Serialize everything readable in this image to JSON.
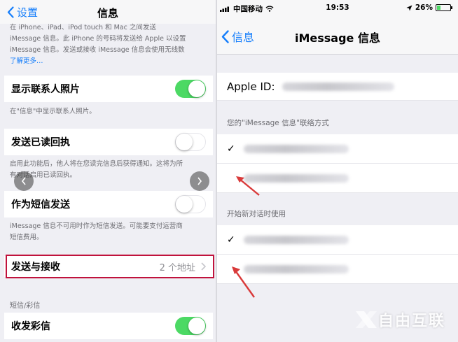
{
  "left": {
    "back_label": "设置",
    "title": "信息",
    "intro_lines": [
      "在 iPhone、iPad、iPod touch 和 Mac 之间发送",
      "iMessage 信息。此 iPhone 的号码将发送给 Apple 以设置",
      "iMessage 信息。发送或接收 iMessage 信息会使用无线数"
    ],
    "learn_more": "了解更多…",
    "show_contact_photos": {
      "label": "显示联系人照片",
      "on": true
    },
    "show_contact_photos_note": "在\"信息\"中显示联系人照片。",
    "read_receipts": {
      "label": "发送已读回执",
      "on": false
    },
    "read_receipts_note": [
      "启用此功能后，他人将在您读完信息后获得通知。这将为所",
      "有对话启用已读回执。"
    ],
    "send_as_sms": {
      "label": "作为短信发送",
      "on": false
    },
    "send_as_sms_note": [
      "iMessage 信息不可用时作为短信发送。可能要支付运营商",
      "短信费用。"
    ],
    "send_receive": {
      "label": "发送与接收",
      "value": "2 个地址"
    },
    "sms_mms_header": "短信/彩信",
    "mms_messaging": {
      "label": "收发彩信",
      "on": true
    }
  },
  "right": {
    "status": {
      "carrier": "中国移动",
      "time": "19:53",
      "battery": "26%",
      "battery_level": 0.26
    },
    "back_label": "信息",
    "title": "iMessage 信息",
    "apple_id_label": "Apple ID:",
    "reach_header": "您的\"iMessage 信息\"联络方式",
    "start_header": "开始新对话时使用"
  },
  "watermark": "自由互联",
  "colors": {
    "ios_blue": "#157efb",
    "toggle_green": "#4cd964",
    "highlight_red": "#c0123c",
    "arrow_red": "#d93a3a"
  }
}
